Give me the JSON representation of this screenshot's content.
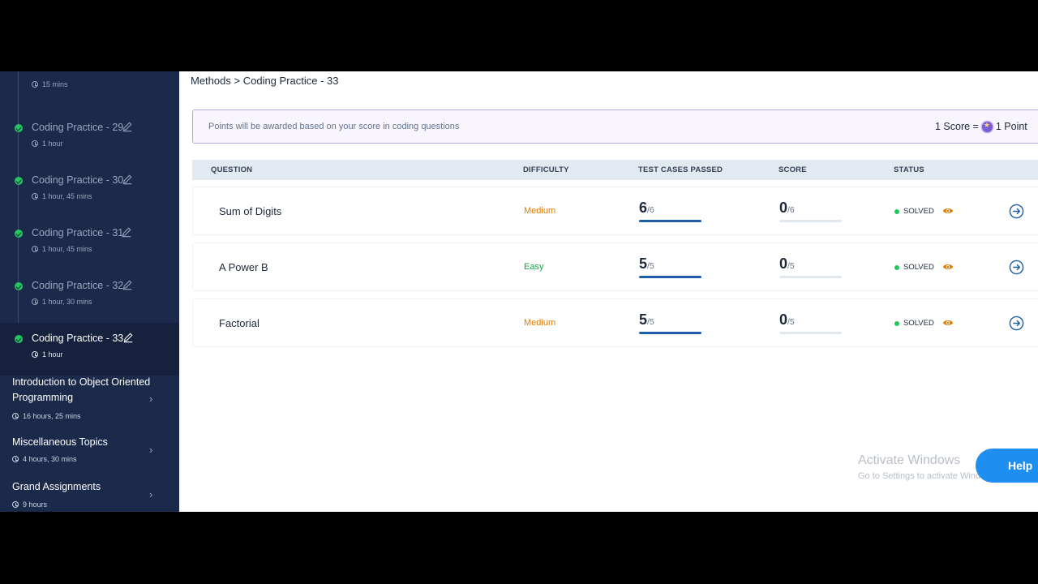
{
  "sidebar": {
    "prev_item_time": "15 mins",
    "items": [
      {
        "title": "Coding Practice - 29",
        "time": "1 hour"
      },
      {
        "title": "Coding Practice - 30",
        "time": "1 hour, 45 mins"
      },
      {
        "title": "Coding Practice - 31",
        "time": "1 hour, 45 mins"
      },
      {
        "title": "Coding Practice - 32",
        "time": "1 hour, 30 mins"
      },
      {
        "title": "Coding Practice - 33",
        "time": "1 hour"
      }
    ],
    "sections": [
      {
        "title": "Introduction to Object Oriented Programming",
        "time": "16 hours, 25 mins"
      },
      {
        "title": "Miscellaneous Topics",
        "time": "4 hours, 30 mins"
      },
      {
        "title": "Grand Assignments",
        "time": "9 hours"
      }
    ]
  },
  "breadcrumb": {
    "parent": "Methods",
    "separator": ">",
    "current": "Coding Practice - 33"
  },
  "banner": {
    "message": "Points will be awarded based on your score in coding questions",
    "rate_left": "1 Score =",
    "rate_right": "1 Point"
  },
  "table": {
    "headers": {
      "question": "QUESTION",
      "difficulty": "DIFFICULTY",
      "test_cases": "TEST CASES PASSED",
      "score": "SCORE",
      "status": "STATUS"
    },
    "rows": [
      {
        "question": "Sum of Digits",
        "difficulty": "Medium",
        "passed": "6",
        "passed_total": "/6",
        "score": "0",
        "score_total": "/6",
        "status": "SOLVED",
        "passed_fraction": 1.0,
        "score_fraction": 0.0
      },
      {
        "question": "A Power B",
        "difficulty": "Easy",
        "passed": "5",
        "passed_total": "/5",
        "score": "0",
        "score_total": "/5",
        "status": "SOLVED",
        "passed_fraction": 1.0,
        "score_fraction": 0.0
      },
      {
        "question": "Factorial",
        "difficulty": "Medium",
        "passed": "5",
        "passed_total": "/5",
        "score": "0",
        "score_total": "/5",
        "status": "SOLVED",
        "passed_fraction": 1.0,
        "score_fraction": 0.0
      }
    ]
  },
  "colors": {
    "medium": "#e07b00",
    "easy": "#16a34a",
    "accent": "#1d5fa8",
    "sidebar_bg": "#1b2a4a"
  },
  "watermark": {
    "line1": "Activate Windows",
    "line2": "Go to Settings to activate Windows."
  },
  "help_label": "Help"
}
